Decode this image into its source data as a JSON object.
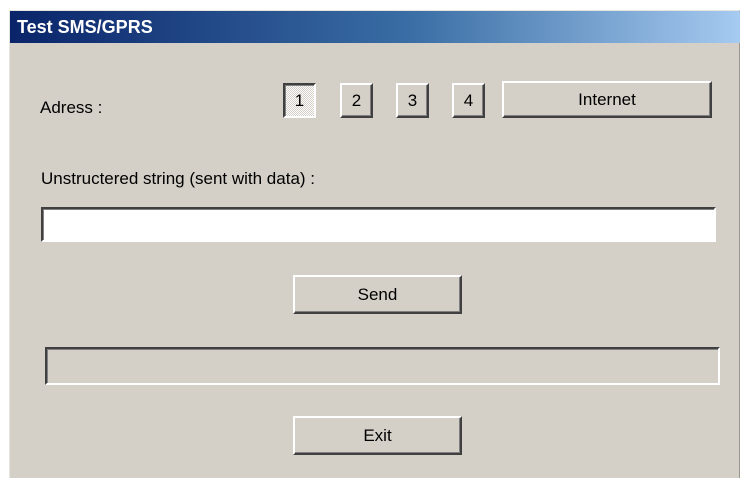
{
  "window": {
    "title": "Test SMS/GPRS"
  },
  "address": {
    "label": "Adress :",
    "buttons": [
      "1",
      "2",
      "3",
      "4"
    ],
    "selected": "1",
    "internet_label": "Internet"
  },
  "message": {
    "label": "Unstructered string (sent with data) :",
    "value": "",
    "placeholder": ""
  },
  "send_label": "Send",
  "status": {
    "value": ""
  },
  "exit_label": "Exit"
}
